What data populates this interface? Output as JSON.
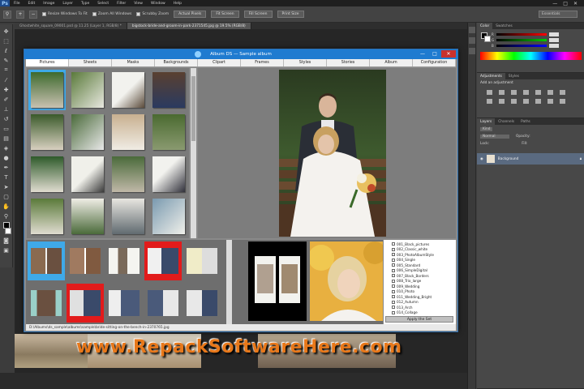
{
  "ps": {
    "logo": "Ps",
    "menu": [
      "File",
      "Edit",
      "Image",
      "Layer",
      "Type",
      "Select",
      "Filter",
      "View",
      "Window",
      "Help"
    ],
    "window_controls": [
      "—",
      "□",
      "✕"
    ],
    "options": {
      "checks": [
        "Resize Windows To Fit",
        "Zoom All Windows",
        "Scrubby Zoom"
      ],
      "buttons": [
        "Actual Pixels",
        "Fit Screen",
        "Fill Screen",
        "Print Size"
      ],
      "workspace": "Essentials"
    },
    "doc_tabs": [
      "Ghostwhite_square_09001.psd @ 11.25 (Layer 1, RGB/8) *",
      "bigstock-bride-and-groom-in-park-2371545.jpg @ 19.5% (RGB/8)"
    ]
  },
  "panels": {
    "color_tabs": [
      "Color",
      "Swatches"
    ],
    "color_channels": [
      {
        "label": "R",
        "value": "",
        "gradient": "linear-gradient(90deg,#000,#f00)"
      },
      {
        "label": "G",
        "value": "",
        "gradient": "linear-gradient(90deg,#000,#0c0)"
      },
      {
        "label": "B",
        "value": "",
        "gradient": "linear-gradient(90deg,#000,#00f)"
      }
    ],
    "adjust_tabs": [
      "Adjustments",
      "Styles"
    ],
    "adjust_hint": "Add an adjustment",
    "layers_tabs": [
      "Layers",
      "Channels",
      "Paths"
    ],
    "layer_kind": "Kind",
    "blend_mode": "Normal",
    "opacity_label": "Opacity:",
    "lock_label": "Lock:",
    "fill_label": "Fill:",
    "layer_name": "Background"
  },
  "album": {
    "title": "Album DS  —  Sample album",
    "tabs": [
      "Pictures",
      "Sheets",
      "Masks",
      "Backgrounds",
      "Clipart",
      "Frames",
      "Styles",
      "Stories",
      "Album",
      "Configuration"
    ],
    "styles": [
      "001_Black_pictures",
      "002_Classic_white",
      "003_PhotoAlbumStyle",
      "004_Single",
      "005_Standard",
      "006_SimpleDigital",
      "007_Black_Borders",
      "008_Trio_large",
      "009_Wedding",
      "010_Photo",
      "011_Wedding_Bright",
      "012_Autumn",
      "013_Arch",
      "014_Collage"
    ],
    "apply_label": "Apply the Set",
    "status_path": "D:\\Albums\\ds_sample\\albums\\sample\\bride-sitting-on-the-bench-in-2370765.jpg"
  },
  "watermark": "www.RepackSoftwareHere.com",
  "colors": {
    "ps_bg": "#3c3c3c",
    "titlebar_blue": "#1f7bd0",
    "selection_blue": "#3fa9e8",
    "selection_red": "#e21b1b",
    "watermark_orange": "#e8781a"
  }
}
